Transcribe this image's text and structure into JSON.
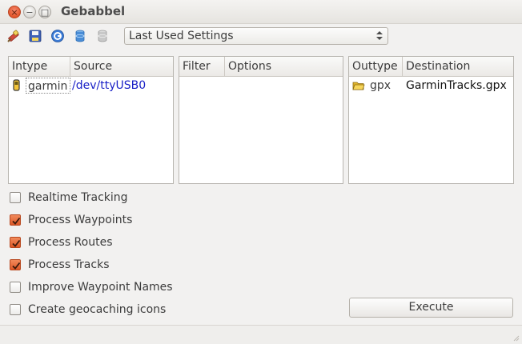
{
  "window": {
    "title": "Gebabbel",
    "buttons": {
      "close": "×",
      "minimize": "−",
      "maximize": "□"
    }
  },
  "toolbar": {
    "icons": [
      "clear-icon",
      "save-icon",
      "help-icon",
      "edit-preset-icon",
      "delete-preset-icon"
    ],
    "preset_select": {
      "selected": "Last Used Settings"
    }
  },
  "input_panel": {
    "columns": [
      "Intype",
      "Source"
    ],
    "rows": [
      {
        "type": "garmin",
        "source": "/dev/ttyUSB0",
        "icon": "gps-device-icon"
      }
    ]
  },
  "filter_panel": {
    "columns": [
      "Filter",
      "Options"
    ]
  },
  "output_panel": {
    "columns": [
      "Outtype",
      "Destination"
    ],
    "rows": [
      {
        "type": "gpx",
        "destination": "GarminTracks.gpx",
        "icon": "folder-icon"
      }
    ]
  },
  "options": [
    {
      "label": "Realtime Tracking",
      "checked": false
    },
    {
      "label": "Process Waypoints",
      "checked": true
    },
    {
      "label": "Process Routes",
      "checked": true
    },
    {
      "label": "Process Tracks",
      "checked": true
    },
    {
      "label": "Improve Waypoint Names",
      "checked": false
    },
    {
      "label": "Create geocaching icons",
      "checked": false
    }
  ],
  "actions": {
    "execute": "Execute"
  },
  "colors": {
    "accent": "#e25b2a",
    "link": "#1a21c7",
    "window_bg": "#f2f1f0"
  }
}
